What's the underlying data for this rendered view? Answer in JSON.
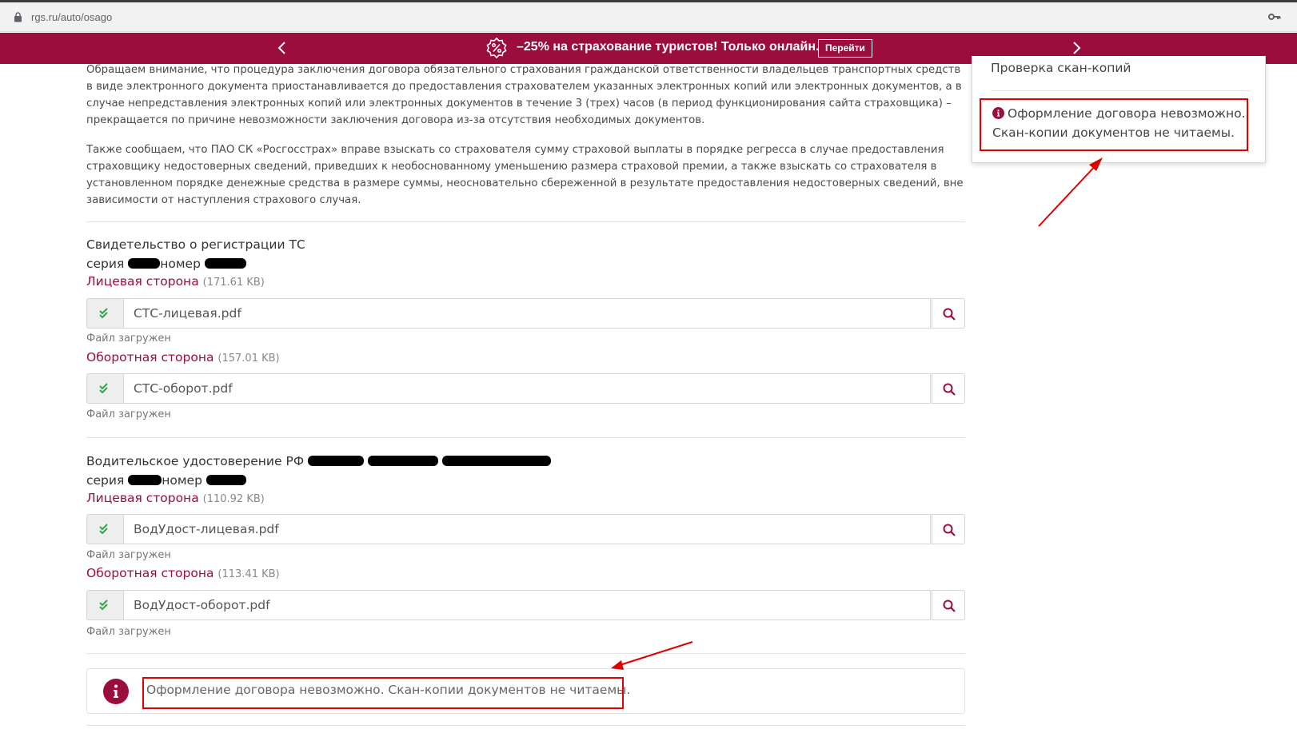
{
  "browser": {
    "url": "rgs.ru/auto/osago",
    "icons": [
      "lock-icon",
      "key-icon"
    ]
  },
  "banner": {
    "text": "–25% на страхование туристов! Только онлайн.",
    "button": "Перейти",
    "background": "#9b0d3c"
  },
  "notice": {
    "paragraph1": "Обращаем внимание, что процедура заключения договора обязательного страхования гражданской ответственности владельцев транспортных средств в виде электронного документа приостанавливается до предоставления страхователем указанных электронных копий или электронных документов, а в случае непредставления электронных копий или электронных документов в течение 3 (трех) часов (в период функционирования сайта страховщика) – прекращается по причине невозможности заключения договора из-за отсутствия необходимых документов.",
    "paragraph2": "Также сообщаем, что ПАО СК «Росгосстрах» вправе взыскать со страхователя сумму страховой выплаты в порядке регресса в случае предоставления страховщику недостоверных сведений, приведших к необоснованному уменьшению размера страховой премии, а также взыскать со страхователя в установленном порядке денежные средства в размере суммы, неосновательно сбереженной в результате предоставления недостоверных сведений, вне зависимости от наступления страхового случая."
  },
  "documents": [
    {
      "title": "Свидетельство о регистрации ТС",
      "series_label": "серия",
      "number_label": "номер",
      "front": {
        "label": "Лицевая сторона",
        "size": "(171.61 KB)",
        "file": "СТС-лицевая.pdf",
        "status": "Файл загружен"
      },
      "back": {
        "label": "Оборотная сторона",
        "size": "(157.01 KB)",
        "file": "СТС-оборот.pdf",
        "status": "Файл загружен"
      }
    },
    {
      "title": "Водительское удостоверение РФ",
      "series_label": "серия",
      "number_label": "номер",
      "front": {
        "label": "Лицевая сторона",
        "size": "(110.92 KB)",
        "file": "ВодУдост-лицевая.pdf",
        "status": "Файл загружен"
      },
      "back": {
        "label": "Оборотная сторона",
        "size": "(113.41 KB)",
        "file": "ВодУдост-оборот.pdf",
        "status": "Файл загружен"
      }
    }
  ],
  "error": {
    "text": "Оформление договора невозможно. Скан-копии документов не читаемы."
  },
  "side_panel": {
    "title": "Проверка скан-копий",
    "message": "Оформление договора невозможно. Скан-копии документов не читаемы."
  },
  "colors": {
    "accent": "#9b0d3c",
    "success": "#2ea44f",
    "annotation": "#e00000"
  }
}
